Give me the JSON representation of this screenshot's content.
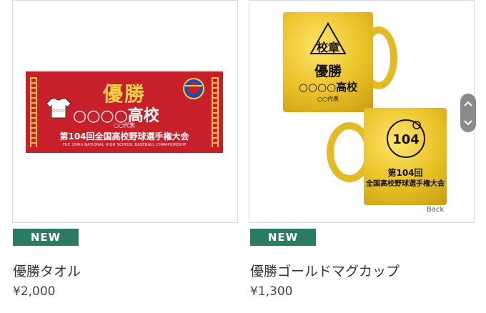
{
  "products": [
    {
      "badge": "NEW",
      "name": "優勝タオル",
      "price": "¥2,000",
      "image": {
        "title": "優勝",
        "school": "○○○○高校",
        "rep": "○○代表",
        "event": "第104回全国高校野球選手権大会",
        "sub": "THE 104th NATIONAL HIGH SCHOOL BASEBALL CHAMPIONSHIP",
        "shirt_text": "○○○○"
      }
    },
    {
      "badge": "NEW",
      "name": "優勝ゴールドマグカップ",
      "price": "¥1,300",
      "image": {
        "crest": "校章",
        "title": "優勝",
        "school": "○○○○高校",
        "rep": "○○代表",
        "event_line1": "第104回",
        "event_line2": "全国高校野球選手権大会",
        "logo_text": "104",
        "back_label": "Back"
      }
    }
  ],
  "colors": {
    "badge": "#2a7a64",
    "towel": "#c8202a",
    "gold": "#e9c025"
  },
  "icons": {
    "scroll_up": "chevron-up-icon",
    "scroll_down": "chevron-down-icon"
  }
}
